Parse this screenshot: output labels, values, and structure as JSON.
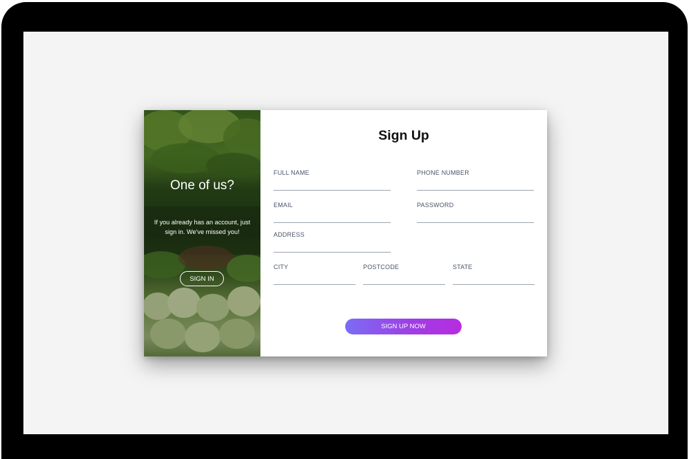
{
  "panel": {
    "title": "One of us?",
    "text": "If you already has an account, just sign in. We've missed you!",
    "signin_label": "SIGN IN"
  },
  "form": {
    "title": "Sign Up",
    "fields": {
      "full_name": "FULL NAME",
      "phone_number": "PHONE NUMBER",
      "email": "EMAIL",
      "password": "PASSWORD",
      "address": "ADDRESS",
      "city": "CITY",
      "postcode": "POSTCODE",
      "state": "STATE"
    },
    "submit_label": "SIGN UP NOW"
  },
  "colors": {
    "button_gradient_start": "#7b6cf6",
    "button_gradient_end": "#b62de0",
    "screen_background": "#f4f4f4",
    "device_frame": "#000000"
  }
}
